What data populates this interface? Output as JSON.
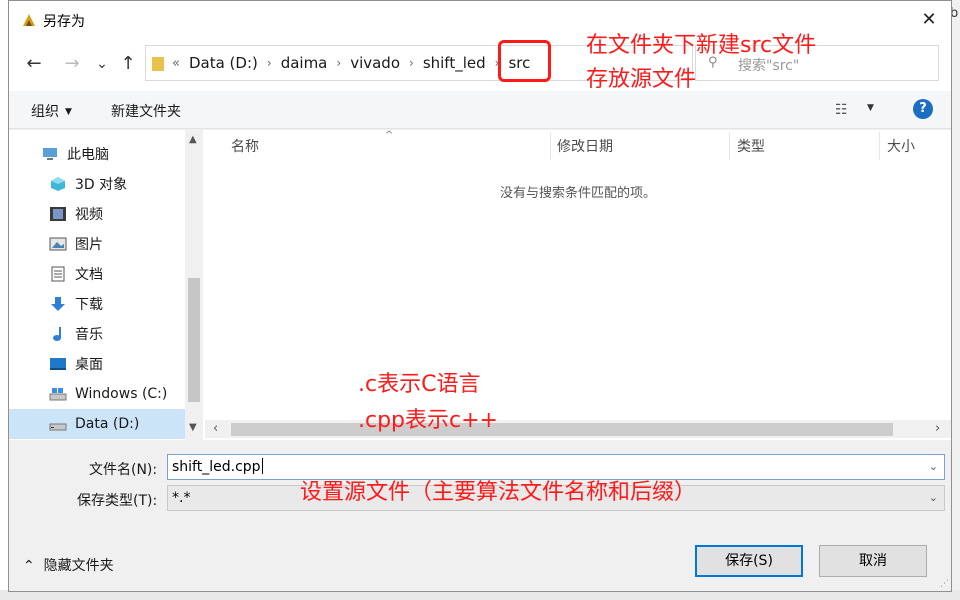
{
  "window": {
    "title": "另存为",
    "close_glyph": "✕"
  },
  "background": {
    "right_edge_text": "b"
  },
  "nav": {
    "back": "←",
    "forward": "→",
    "recent": "⌄",
    "up": "↑"
  },
  "address": {
    "overflow": "«",
    "crumbs": [
      "Data (D:)",
      "daima",
      "vivado",
      "shift_led",
      "src"
    ],
    "separator": "›"
  },
  "search": {
    "placeholder": "搜索\"src\""
  },
  "toolbar": {
    "organize": "组织",
    "new_folder": "新建文件夹",
    "help": "?"
  },
  "sidebar": {
    "items": [
      {
        "label": "此电脑",
        "icon": "computer-icon"
      },
      {
        "label": "3D 对象",
        "icon": "cube-icon"
      },
      {
        "label": "视频",
        "icon": "video-icon"
      },
      {
        "label": "图片",
        "icon": "picture-icon"
      },
      {
        "label": "文档",
        "icon": "document-icon"
      },
      {
        "label": "下载",
        "icon": "download-icon"
      },
      {
        "label": "音乐",
        "icon": "music-icon"
      },
      {
        "label": "桌面",
        "icon": "desktop-icon"
      },
      {
        "label": "Windows (C:)",
        "icon": "drive-icon"
      },
      {
        "label": "Data (D:)",
        "icon": "drive-icon",
        "selected": true
      }
    ]
  },
  "list": {
    "columns": [
      "名称",
      "修改日期",
      "类型",
      "大小"
    ],
    "empty_message": "没有与搜索条件匹配的项。"
  },
  "form": {
    "filename_label": "文件名(N):",
    "filename_value": "shift_led.cpp",
    "filetype_label": "保存类型(T):",
    "filetype_value": "*.*"
  },
  "footer": {
    "hide_folders": "隐藏文件夹",
    "save": "保存(S)",
    "cancel": "取消"
  },
  "annotations": {
    "top_line1": "在文件夹下新建src文件",
    "top_line2": "存放源文件",
    "mid_line1": ".c表示C语言",
    "mid_line2": ".cpp表示c++",
    "bottom": "设置源文件（主要算法文件名称和后缀）",
    "color": "#ff1a1a"
  }
}
